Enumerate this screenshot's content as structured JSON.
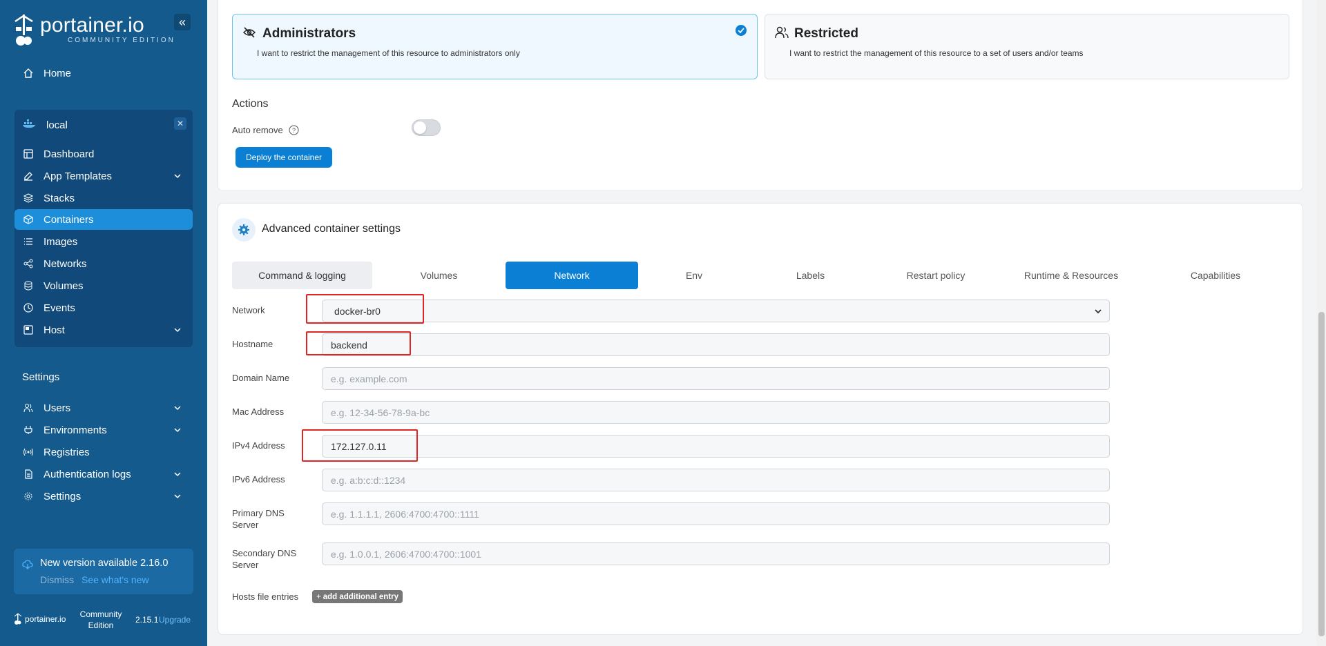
{
  "brand": {
    "name": "portainer.io",
    "edition": "COMMUNITY EDITION"
  },
  "sidebar": {
    "home": "Home",
    "environment": {
      "name": "local"
    },
    "env_items": [
      {
        "label": "Dashboard",
        "icon": "dashboard-icon"
      },
      {
        "label": "App Templates",
        "icon": "edit-icon",
        "expandable": true
      },
      {
        "label": "Stacks",
        "icon": "layers-icon"
      },
      {
        "label": "Containers",
        "icon": "box-icon",
        "active": true
      },
      {
        "label": "Images",
        "icon": "list-icon"
      },
      {
        "label": "Networks",
        "icon": "share-icon"
      },
      {
        "label": "Volumes",
        "icon": "database-icon"
      },
      {
        "label": "Events",
        "icon": "clock-icon"
      },
      {
        "label": "Host",
        "icon": "server-icon",
        "expandable": true
      }
    ],
    "settings_title": "Settings",
    "settings_items": [
      {
        "label": "Users",
        "icon": "users-icon",
        "expandable": true
      },
      {
        "label": "Environments",
        "icon": "plug-icon",
        "expandable": true
      },
      {
        "label": "Registries",
        "icon": "radio-icon",
        "expandable": false
      },
      {
        "label": "Authentication logs",
        "icon": "file-icon",
        "expandable": true
      },
      {
        "label": "Settings",
        "icon": "gear-icon",
        "expandable": true
      }
    ],
    "update": {
      "title": "New version available 2.16.0",
      "dismiss": "Dismiss",
      "link": "See what's new"
    },
    "footer": {
      "logo": "portainer.io",
      "edition_line1": "Community",
      "edition_line2": "Edition",
      "version": "2.15.1",
      "upgrade": "Upgrade"
    }
  },
  "access_control": {
    "admin": {
      "title": "Administrators",
      "desc": "I want to restrict the management of this resource to administrators only",
      "selected": true
    },
    "restricted": {
      "title": "Restricted",
      "desc": "I want to restrict the management of this resource to a set of users and/or teams"
    }
  },
  "actions": {
    "title": "Actions",
    "auto_remove_label": "Auto remove",
    "auto_remove": false,
    "deploy_label": "Deploy the container"
  },
  "advanced": {
    "title": "Advanced container settings",
    "tabs": [
      "Command & logging",
      "Volumes",
      "Network",
      "Env",
      "Labels",
      "Restart policy",
      "Runtime & Resources",
      "Capabilities"
    ],
    "active_tab": "Network"
  },
  "network_form": {
    "network": {
      "label": "Network",
      "value": "docker-br0"
    },
    "hostname": {
      "label": "Hostname",
      "value": "backend"
    },
    "domain": {
      "label": "Domain Name",
      "placeholder": "e.g. example.com"
    },
    "mac": {
      "label": "Mac Address",
      "placeholder": "e.g. 12-34-56-78-9a-bc"
    },
    "ipv4": {
      "label": "IPv4 Address",
      "value": "172.127.0.11"
    },
    "ipv6": {
      "label": "IPv6 Address",
      "placeholder": "e.g. a:b:c:d::1234"
    },
    "dns1": {
      "label_line1": "Primary DNS",
      "label_line2": "Server",
      "placeholder": "e.g. 1.1.1.1, 2606:4700:4700::1111"
    },
    "dns2": {
      "label_line1": "Secondary DNS",
      "label_line2": "Server",
      "placeholder": "e.g. 1.0.0.1, 2606:4700:4700::1001"
    },
    "hosts": {
      "label": "Hosts file entries",
      "button": "add additional entry"
    }
  },
  "colors": {
    "sidebar": "#155a8c",
    "accent": "#0b7fd4",
    "highlight": "#e02424"
  }
}
